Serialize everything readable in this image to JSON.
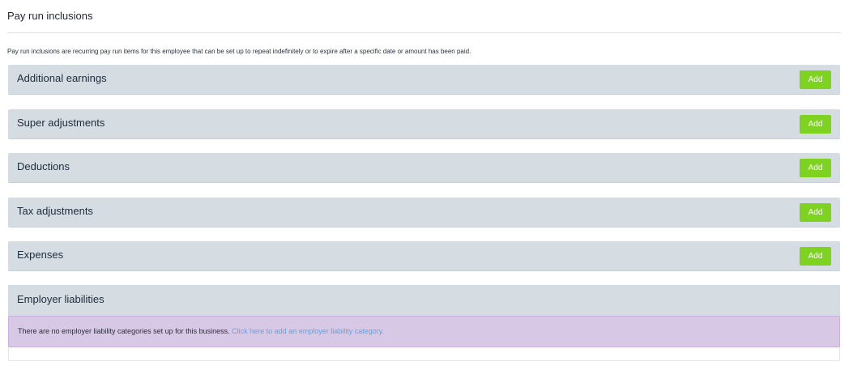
{
  "page": {
    "title": "Pay run inclusions",
    "intro": "Pay run inclusions are recurring pay run items for this employee that can be set up to repeat indefinitely or to expire after a specific date or amount has been paid."
  },
  "sections": [
    {
      "title": "Additional earnings",
      "add_label": "Add"
    },
    {
      "title": "Super adjustments",
      "add_label": "Add"
    },
    {
      "title": "Deductions",
      "add_label": "Add"
    },
    {
      "title": "Tax adjustments",
      "add_label": "Add"
    },
    {
      "title": "Expenses",
      "add_label": "Add"
    }
  ],
  "employer_liabilities": {
    "title": "Employer liabilities",
    "message": "There are no employer liability categories set up for this business.",
    "link_text": "Click here to add an employer liability category."
  },
  "colors": {
    "add_button": "#7ed321",
    "panel_bg": "#d6dde2",
    "alert_bg": "#d7c8e6",
    "link": "#5aa6e6"
  }
}
